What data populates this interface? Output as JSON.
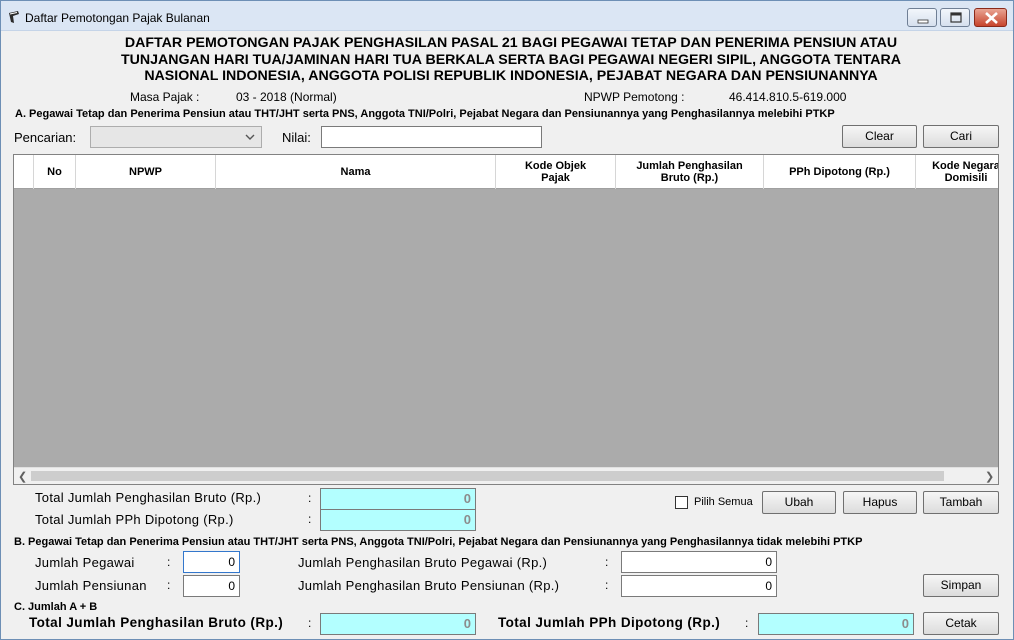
{
  "window": {
    "title": "Daftar Pemotongan Pajak Bulanan"
  },
  "header": {
    "line1": "DAFTAR PEMOTONGAN PAJAK PENGHASILAN PASAL 21 BAGI PEGAWAI TETAP DAN PENERIMA PENSIUN ATAU",
    "line2": "TUNJANGAN HARI TUA/JAMINAN HARI TUA BERKALA SERTA BAGI PEGAWAI NEGERI SIPIL, ANGGOTA TENTARA",
    "line3": "NASIONAL INDONESIA, ANGGOTA POLISI REPUBLIK INDONESIA, PEJABAT NEGARA DAN PENSIUNANNYA",
    "masa_label": "Masa Pajak :",
    "masa_value": "03 - 2018 (Normal)",
    "npwp_label": "NPWP Pemotong :",
    "npwp_value": "46.414.810.5-619.000"
  },
  "section_a": {
    "title": "A. Pegawai Tetap dan Penerima Pensiun atau THT/JHT serta PNS, Anggota TNI/Polri, Pejabat Negara dan Pensiunannya yang Penghasilannya melebihi PTKP",
    "search_label": "Pencarian:",
    "search_value": "",
    "nilai_label": "Nilai:",
    "nilai_value": "",
    "clear_label": "Clear",
    "cari_label": "Cari",
    "columns": [
      "No",
      "NPWP",
      "Nama",
      "Kode Objek Pajak",
      "Jumlah Penghasilan Bruto (Rp.)",
      "PPh Dipotong (Rp.)",
      "Kode Negara Domisili"
    ],
    "total_bruto_label": "Total Jumlah Penghasilan Bruto (Rp.)",
    "total_bruto_value": "0",
    "total_pph_label": "Total Jumlah PPh Dipotong (Rp.)",
    "total_pph_value": "0",
    "pilih_semua_label": "Pilih Semua",
    "ubah_label": "Ubah",
    "hapus_label": "Hapus",
    "tambah_label": "Tambah",
    "colon": ":"
  },
  "section_b": {
    "title": "B. Pegawai Tetap dan Penerima Pensiun atau THT/JHT serta PNS, Anggota TNI/Polri, Pejabat Negara dan Pensiunannya yang Penghasilannya tidak melebihi PTKP",
    "jumlah_pegawai_label": "Jumlah Pegawai",
    "jumlah_pegawai_value": "0",
    "jumlah_pensiunan_label": "Jumlah Pensiunan",
    "jumlah_pensiunan_value": "0",
    "bruto_pegawai_label": "Jumlah Penghasilan Bruto Pegawai (Rp.)",
    "bruto_pegawai_value": "0",
    "bruto_pensiunan_label": "Jumlah Penghasilan Bruto Pensiunan (Rp.)",
    "bruto_pensiunan_value": "0",
    "simpan_label": "Simpan"
  },
  "section_c": {
    "title": "C. Jumlah A + B",
    "total_bruto_label": "Total Jumlah Penghasilan Bruto (Rp.)",
    "total_bruto_value": "0",
    "total_pph_label": "Total Jumlah PPh Dipotong (Rp.)",
    "total_pph_value": "0",
    "cetak_label": "Cetak"
  }
}
